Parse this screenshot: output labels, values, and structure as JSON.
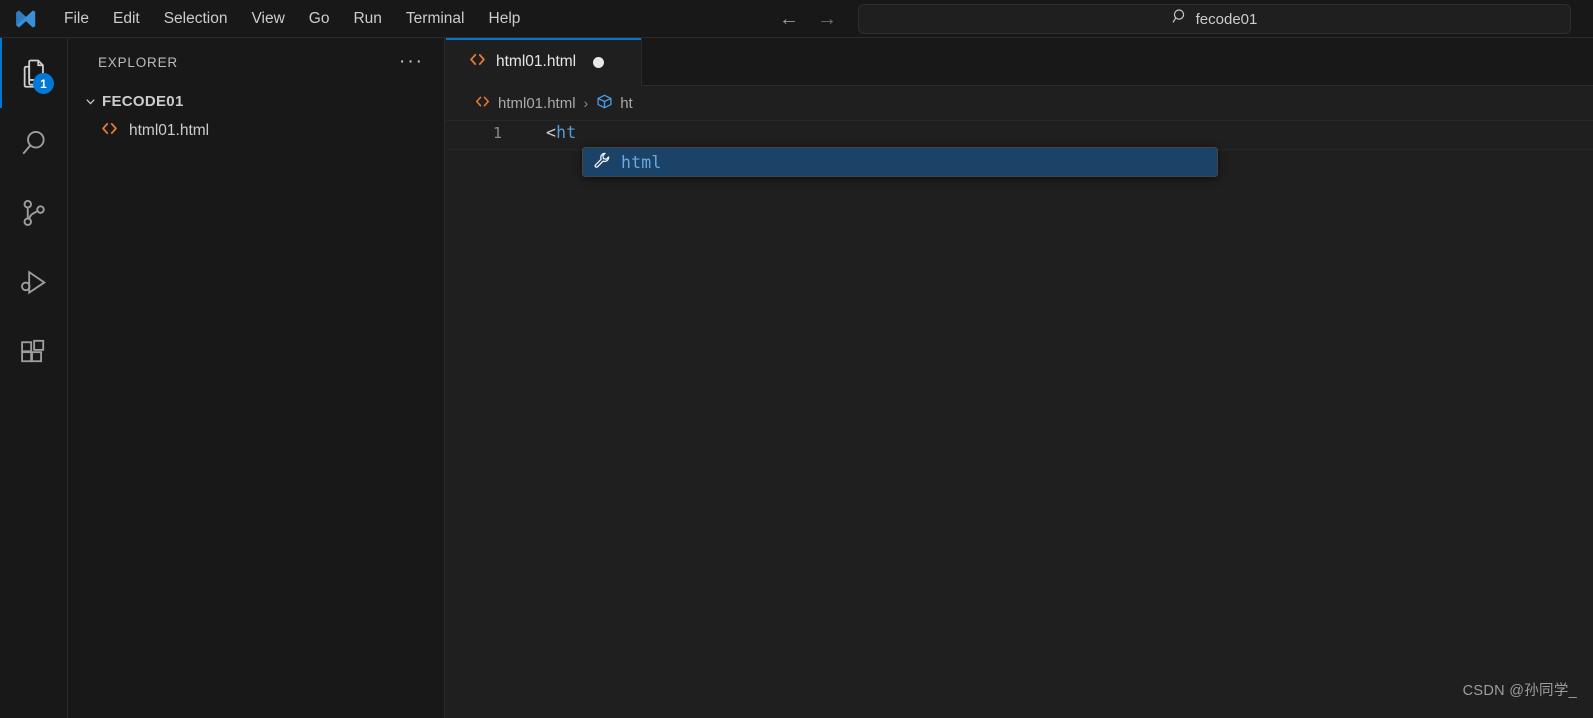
{
  "app": {
    "name": "Visual Studio Code",
    "logo_icon": "vscode-logo-icon"
  },
  "titlebar": {
    "menus": [
      {
        "label": "File"
      },
      {
        "label": "Edit"
      },
      {
        "label": "Selection"
      },
      {
        "label": "View"
      },
      {
        "label": "Go"
      },
      {
        "label": "Run"
      },
      {
        "label": "Terminal"
      },
      {
        "label": "Help"
      }
    ],
    "nav": {
      "back_icon": "arrow-left-icon",
      "back_label": "←",
      "forward_icon": "arrow-right-icon",
      "forward_label": "→"
    },
    "command_center": {
      "icon": "search-icon",
      "text": "fecode01"
    }
  },
  "activitybar": {
    "items": [
      {
        "id": "explorer",
        "icon": "files-explorer-icon",
        "badge": "1",
        "active": true
      },
      {
        "id": "search",
        "icon": "search-icon",
        "badge": null,
        "active": false
      },
      {
        "id": "source-control",
        "icon": "source-control-branch-icon",
        "badge": null,
        "active": false
      },
      {
        "id": "run-debug",
        "icon": "run-and-debug-icon",
        "badge": null,
        "active": false
      },
      {
        "id": "extensions",
        "icon": "extensions-blocks-icon",
        "badge": null,
        "active": false
      }
    ]
  },
  "sidebar": {
    "title": "EXPLORER",
    "more_actions_icon": "ellipsis-icon",
    "more_actions_label": "···",
    "tree": {
      "root": {
        "label": "FECODE01",
        "expanded": true,
        "chevron_icon": "chevron-down-icon"
      },
      "files": [
        {
          "label": "html01.html",
          "icon": "html-file-icon"
        }
      ]
    }
  },
  "editor": {
    "tabs": [
      {
        "label": "html01.html",
        "icon": "html-file-icon",
        "dirty": true,
        "active": true
      }
    ],
    "breadcrumb": [
      {
        "label": "html01.html",
        "icon": "html-file-icon"
      },
      {
        "label": "ht",
        "icon": "symbol-cube-icon"
      }
    ],
    "breadcrumb_separator": "›",
    "code": {
      "lines": [
        {
          "number": "1",
          "tokens": [
            {
              "text": "<",
              "type": "punct"
            },
            {
              "text": "ht",
              "type": "tag"
            }
          ]
        }
      ]
    },
    "suggest": {
      "visible": true,
      "items": [
        {
          "label": "html",
          "icon": "snippet-wrench-icon",
          "selected": true
        }
      ]
    }
  },
  "watermark": {
    "text": "CSDN @孙同学_"
  },
  "colors": {
    "accent": "#0078d4",
    "titlebar_bg": "#181818",
    "sidebar_bg": "#181818",
    "editor_bg": "#1f1f1f",
    "html_icon": "#e37933",
    "tag_blue": "#569cd6",
    "suggest_selected_bg": "#1b4368"
  }
}
